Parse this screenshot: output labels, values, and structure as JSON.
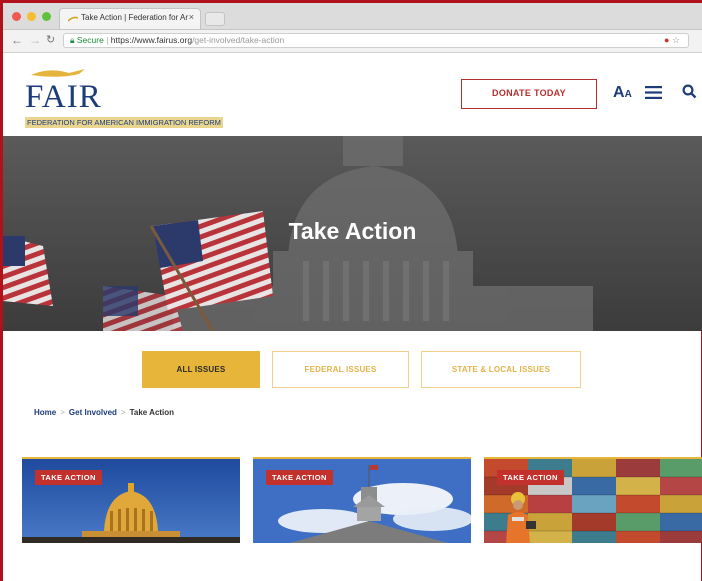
{
  "browser": {
    "tab_title": "Take Action | Federation for Ar",
    "tab_close": "×",
    "url_secure_label": "Secure",
    "url_host": "https://www.fairus.org",
    "url_path": "/get-involved/take-action"
  },
  "header": {
    "logo_text": "FAIR",
    "logo_subtitle": "FEDERATION FOR AMERICAN IMMIGRATION REFORM",
    "donate_label": "DONATE TODAY",
    "icons": [
      "text-size-icon",
      "menu-icon",
      "search-icon"
    ]
  },
  "hero": {
    "title": "Take Action"
  },
  "filters": [
    {
      "label": "ALL ISSUES",
      "active": true
    },
    {
      "label": "FEDERAL ISSUES",
      "active": false
    },
    {
      "label": "STATE & LOCAL ISSUES",
      "active": false
    }
  ],
  "breadcrumb": {
    "home": "Home",
    "parent": "Get Involved",
    "current": "Take Action",
    "separator": ">"
  },
  "cards": [
    {
      "badge": "TAKE ACTION",
      "image": "capitol-dome"
    },
    {
      "badge": "TAKE ACTION",
      "image": "state-capitol"
    },
    {
      "badge": "TAKE ACTION",
      "image": "shipping-containers"
    }
  ],
  "colors": {
    "brand_navy": "#1d3c7a",
    "accent_gold": "#e7b53a",
    "donate_red": "#b3302d",
    "badge_red": "#c2312b"
  }
}
